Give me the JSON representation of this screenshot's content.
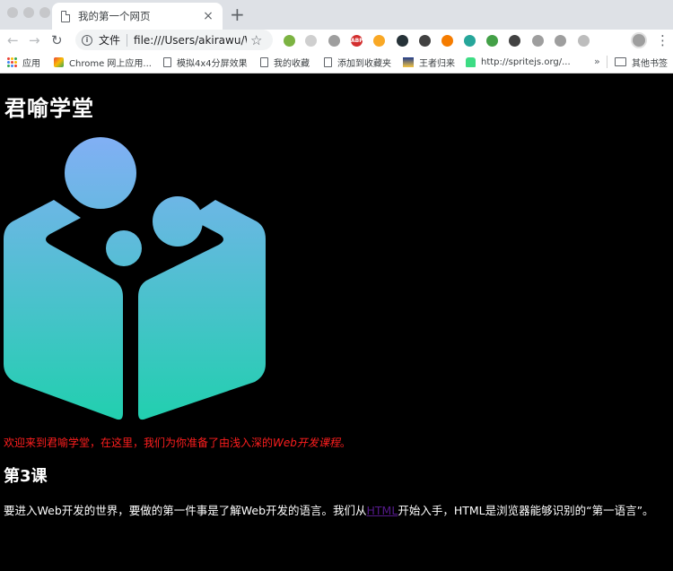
{
  "browser": {
    "tab_title": "我的第一个网页",
    "tab_close": "×",
    "new_tab": "+",
    "omnibox": {
      "scheme_label": "文件",
      "url": "file:///Users/akirawu/W..."
    },
    "extensions": [
      {
        "name": "ext-green-circle",
        "color": "#7cb342",
        "label": ""
      },
      {
        "name": "ext-grey-circle",
        "color": "#cfcfcf",
        "label": ""
      },
      {
        "name": "ext-save",
        "color": "#9e9e9e",
        "label": ""
      },
      {
        "name": "ext-abp",
        "color": "#d32f2f",
        "label": "ABP"
      },
      {
        "name": "ext-cookie",
        "color": "#f9a825",
        "label": ""
      },
      {
        "name": "ext-fire",
        "color": "#263238",
        "label": ""
      },
      {
        "name": "ext-shield",
        "color": "#424242",
        "label": ""
      },
      {
        "name": "ext-orange",
        "color": "#f57c00",
        "label": ""
      },
      {
        "name": "ext-teal",
        "color": "#26a69a",
        "label": ""
      },
      {
        "name": "ext-wechat",
        "color": "#43a047",
        "label": ""
      },
      {
        "name": "ext-pen",
        "color": "#424242",
        "label": ""
      },
      {
        "name": "ext-vue",
        "color": "#9e9e9e",
        "label": ""
      },
      {
        "name": "ext-refresh",
        "color": "#9e9e9e",
        "label": ""
      },
      {
        "name": "ext-pin",
        "color": "#bdbdbd",
        "label": ""
      }
    ],
    "bookmarks": [
      {
        "label": "应用",
        "icon": "apps-grid-icon"
      },
      {
        "label": "Chrome 网上应用...",
        "icon": "chrome-store-icon"
      },
      {
        "label": "模拟4x4分屏效果",
        "icon": "page-icon"
      },
      {
        "label": "我的收藏",
        "icon": "page-icon"
      },
      {
        "label": "添加到收藏夹",
        "icon": "page-icon"
      },
      {
        "label": "王者归来",
        "icon": "image-icon"
      },
      {
        "label": "http://spritejs.org/...",
        "icon": "android-icon"
      }
    ],
    "overflow": "»",
    "other_bookmarks": "其他书签"
  },
  "page": {
    "heading": "君喻学堂",
    "intro_text": "欢迎来到君喻学堂，在这里，我们为你准备了由浅入深的",
    "intro_emphasis": "Web开发课程",
    "intro_end": "。",
    "lesson_heading": "第3课",
    "paragraph_start": "要进入Web开发的世界，要做的第一件事是了解Web开发的语言。我们从",
    "paragraph_link": "HTML",
    "paragraph_end": "开始入手，HTML是浏览器能够识别的“第一语言”。",
    "colors": {
      "background": "#000000",
      "intro_text": "#ff1e1e",
      "link_visited": "#551a8b",
      "logo_top": "#82aff5",
      "logo_bottom": "#1fd0ad"
    }
  }
}
